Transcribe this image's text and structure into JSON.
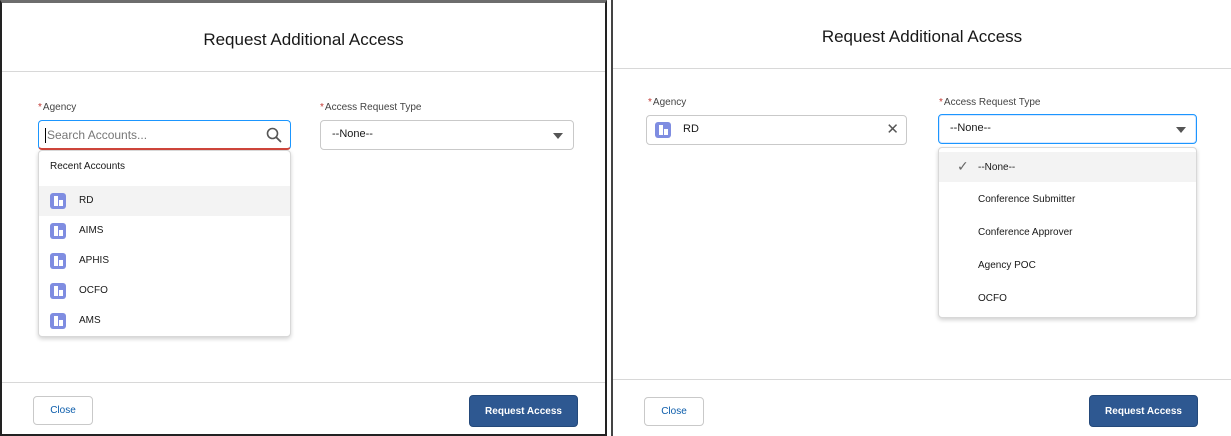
{
  "left": {
    "title": "Request Additional Access",
    "agency_label": "Agency",
    "agency_placeholder": "Search Accounts...",
    "type_label": "Access Request Type",
    "type_value": "--None--",
    "dropdown_header": "Recent Accounts",
    "recent_accounts": [
      "RD",
      "AIMS",
      "APHIS",
      "OCFO",
      "AMS"
    ],
    "close_label": "Close",
    "submit_label": "Request Access"
  },
  "right": {
    "title": "Request Additional Access",
    "agency_label": "Agency",
    "agency_value": "RD",
    "type_label": "Access Request Type",
    "type_value": "--None--",
    "type_options": [
      "--None--",
      "Conference Submitter",
      "Conference Approver",
      "Agency POC",
      "OCFO"
    ],
    "selected_option": "--None--",
    "close_label": "Close",
    "submit_label": "Request Access"
  },
  "icons": {
    "required_mark": "*",
    "search": "search-icon",
    "dropdown": "chevron-down-icon",
    "clear": "close-icon",
    "check": "✓",
    "account": "account-icon"
  },
  "colors": {
    "brand": "#2e5891",
    "required": "#c23934",
    "focus": "#1b96ff",
    "account_icon": "#7f8de1"
  }
}
